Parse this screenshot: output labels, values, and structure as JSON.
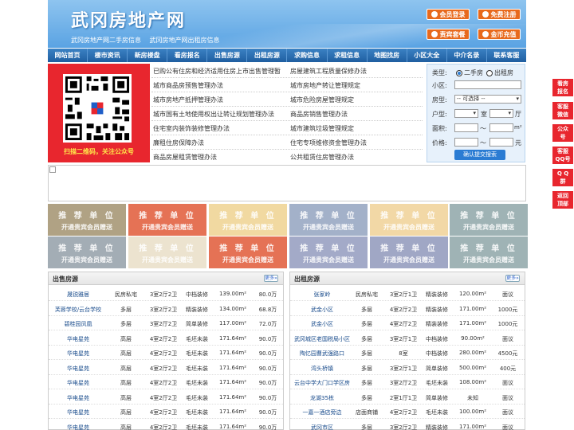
{
  "header": {
    "title": "武冈房地产网",
    "links": [
      "武冈房地产网二手房信息",
      "武冈房地产网出租房信息"
    ],
    "buttons": [
      "会员登录",
      "免费注册",
      "责宾套餐",
      "金币充值"
    ]
  },
  "nav": [
    "网站首页",
    "楼市资讯",
    "新房楼盘",
    "看房报名",
    "出售房源",
    "出租房源",
    "求购信息",
    "求租信息",
    "地图找房",
    "小区大全",
    "中介名录",
    "联系客服"
  ],
  "qr": {
    "caption": "扫描二维码，关注公众号"
  },
  "news": {
    "left": [
      "已购公有住房和经济适用住房上市出售管理暂",
      "城市商品房预售管理办法",
      "城市房地产抵押管理办法",
      "城市国有土地使用权出让转让规划管理办法",
      "住宅室内装饰装修管理办法",
      "廉租住房保障办法",
      "商品房屋租赁管理办法"
    ],
    "right": [
      "房屋建筑工程质量保修办法",
      "城市房地产转让管理规定",
      "城市危险房屋管理规定",
      "商品房销售管理办法",
      "城市建筑垃圾管理规定",
      "住宅专项维修资金管理办法",
      "公共租赁住房管理办法"
    ]
  },
  "search": {
    "type_label": "类型:",
    "opt1": "二手房",
    "opt2": "出租房",
    "area_label": "小区:",
    "style_label": "房型:",
    "style_value": "-- 可选择 --",
    "layout_label": "户型:",
    "room": "室",
    "hall": "厅",
    "size_label": "面积:",
    "price_label": "价格:",
    "unit_m2": "m²",
    "unit_yuan": "元",
    "tilde": "～",
    "button": "确认提交搜索"
  },
  "ads": {
    "t1": "推 荐 单 位",
    "t2": "开通贵宾会员赠送"
  },
  "sale": {
    "title": "出售房源",
    "more": "更多»",
    "rows": [
      [
        "晟锐雅居",
        "民房私宅",
        "3室2厅2卫",
        "中档装修",
        "139.00m²",
        "80.0万"
      ],
      [
        "芙蓉学校/云台学校",
        "多层",
        "3室2厅2卫",
        "精装装修",
        "134.00m²",
        "68.8万"
      ],
      [
        "碧桂园凤凰",
        "多层",
        "3室2厅2卫",
        "简单装修",
        "117.00m²",
        "72.0万"
      ],
      [
        "华电星苑",
        "高层",
        "4室2厅2卫",
        "毛坯未装",
        "171.64m²",
        "90.0万"
      ],
      [
        "华电星苑",
        "高层",
        "4室2厅2卫",
        "毛坯未装",
        "171.64m²",
        "90.0万"
      ],
      [
        "华电星苑",
        "高层",
        "4室2厅2卫",
        "毛坯未装",
        "171.64m²",
        "90.0万"
      ],
      [
        "华电星苑",
        "高层",
        "4室2厅2卫",
        "毛坯未装",
        "171.64m²",
        "90.0万"
      ],
      [
        "华电星苑",
        "高层",
        "4室2厅2卫",
        "毛坯未装",
        "171.64m²",
        "90.0万"
      ],
      [
        "华电星苑",
        "高层",
        "4室2厅2卫",
        "毛坯未装",
        "171.64m²",
        "90.0万"
      ],
      [
        "华电星苑",
        "高层",
        "4室2厅2卫",
        "毛坯未装",
        "171.64m²",
        "90.0万"
      ],
      [
        "华电星苑",
        "高层",
        "4室2厅2卫",
        "毛坯未装",
        "171.64m²",
        "90.0万"
      ]
    ]
  },
  "rent": {
    "title": "出租房源",
    "more": "更多»",
    "rows": [
      [
        "张家岭",
        "民房私宅",
        "3室2厅1卫",
        "精装装修",
        "120.00m²",
        "面议"
      ],
      [
        "武金小区",
        "多层",
        "4室2厅2卫",
        "精装装修",
        "171.00m²",
        "1000元"
      ],
      [
        "武金小区",
        "多层",
        "4室2厅2卫",
        "精装装修",
        "171.00m²",
        "1000元"
      ],
      [
        "武冈城区老国税局小区",
        "多层",
        "3室2厅1卫",
        "中档装修",
        "90.00m²",
        "面议"
      ],
      [
        "陶忆园曹武强路口",
        "多层",
        "8室",
        "中档装修",
        "280.00m²",
        "4500元"
      ],
      [
        "湾头桥镇",
        "多层",
        "3室2厅1卫",
        "简单装修",
        "500.00m²",
        "400元"
      ],
      [
        "云台中学大门口学区房",
        "多层",
        "3室2厅2卫",
        "毛坯未装",
        "108.00m²",
        "面议"
      ],
      [
        "龙湖35栋",
        "多层",
        "2室1厅1卫",
        "简单装修",
        "未知",
        "面议"
      ],
      [
        "一嘉一酒店旁边",
        "店面商铺",
        "4室2厅2卫",
        "毛坯未装",
        "100.00m²",
        "面议"
      ],
      [
        "武冈市区",
        "多层",
        "3室2厅2卫",
        "精装装修",
        "171.00m²",
        "面议"
      ]
    ]
  },
  "side": [
    [
      "看房",
      "报名"
    ],
    [
      "客服",
      "微信"
    ],
    [
      "公众",
      "号"
    ],
    [
      "客服",
      "QQ号"
    ],
    [
      "Q Q",
      "群"
    ],
    [
      "返回",
      "顶部"
    ]
  ],
  "colors": {
    "nav": "#2a6fb3",
    "accent": "#e8691c",
    "red": "#e8262e"
  }
}
